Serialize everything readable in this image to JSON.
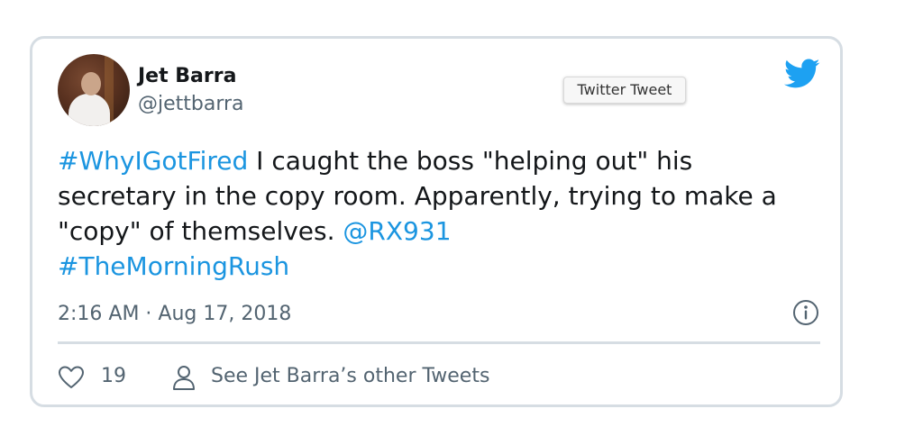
{
  "tooltip": "Twitter Tweet",
  "author": {
    "name": "Jet Barra",
    "handle": "@jettbarra"
  },
  "tweet": {
    "hashtag1": "#WhyIGotFired",
    "text1": " I caught the boss \"helping out\" his secretary in the copy room. Apparently, trying to make a \"copy\" of themselves. ",
    "mention": "@RX931",
    "hashtag2": "#TheMorningRush"
  },
  "timestamp": "2:16 AM · Aug 17, 2018",
  "actions": {
    "like_count": "19",
    "other_tweets_label": "See Jet Barra’s other Tweets"
  },
  "icons": {
    "brand": "twitter-bird-icon",
    "info": "info-icon",
    "like": "heart-icon",
    "profile": "person-icon"
  },
  "colors": {
    "link": "#1b95e0",
    "twitter_blue": "#1da1f2",
    "muted_text": "#536471",
    "border": "#d6dde3"
  }
}
